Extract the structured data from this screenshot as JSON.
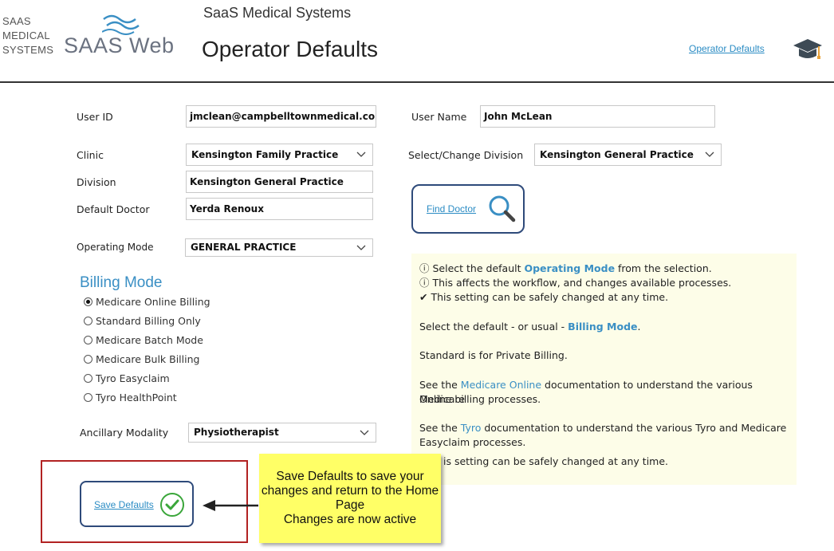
{
  "logo": {
    "line1": "SAAS",
    "line2": "MEDICAL",
    "line3": "SYSTEMS",
    "product": "SAAS Web"
  },
  "header": {
    "company": "SaaS Medical Systems",
    "title": "Operator Defaults",
    "link": "Operator Defaults"
  },
  "form": {
    "user_id_label": "User ID",
    "user_id_value": "jmclean@campbelltownmedical.com.au",
    "user_name_label": "User Name",
    "user_name_value": "John McLean",
    "clinic_label": "Clinic",
    "clinic_value": "Kensington Family Practice",
    "select_division_label": "Select/Change Division",
    "select_division_value": "Kensington General Practice",
    "division_label": "Division",
    "division_value": "Kensington General Practice",
    "default_doctor_label": "Default Doctor",
    "default_doctor_value": "Yerda Renoux",
    "operating_mode_label": "Operating Mode",
    "operating_mode_value": "GENERAL PRACTICE",
    "ancillary_label": "Ancillary Modality",
    "ancillary_value": "Physiotherapist"
  },
  "billing": {
    "title": "Billing Mode",
    "options": [
      {
        "label": "Medicare Online Billing",
        "selected": true
      },
      {
        "label": "Standard Billing Only",
        "selected": false
      },
      {
        "label": "Medicare Batch Mode",
        "selected": false
      },
      {
        "label": "Medicare Bulk Billing",
        "selected": false
      },
      {
        "label": "Tyro Easyclaim",
        "selected": false
      },
      {
        "label": "Tyro HealthPoint",
        "selected": false
      }
    ]
  },
  "find_doctor": {
    "label": "Find Doctor",
    "icon": "magnifier-icon"
  },
  "info": {
    "l1_pre": "Select the default ",
    "l1_kw": "Operating Mode",
    "l1_post": " from the selection.",
    "l2": "This affects the workflow, and changes available processes.",
    "l3": "This setting can be safely changed at any time.",
    "l4_pre": "Select the default - or usual - ",
    "l4_kw": "Billing Mode",
    "l4_post": ".",
    "l5": "Standard is for Private Billing.",
    "l6_pre": "See the ",
    "l6_kw": "Medicare Online",
    "l6_post": " documentation to understand the various Medicare",
    "l6b": "Online billing processes.",
    "l7_pre": "See the ",
    "l7_kw": "Tyro",
    "l7_post": " documentation to understand the various Tyro and Medicare",
    "l7b": "Easyclaim processes.",
    "l8": "is setting can be safely changed at any time."
  },
  "save": {
    "label": "Save Defaults",
    "icon": "checkmark-icon"
  },
  "callout": {
    "l1": "Save Defaults to save your",
    "l2": "changes and return to the Home",
    "l3": "Page",
    "l4": "Changes are now active"
  },
  "colors": {
    "accent": "#3a8fc4",
    "button_border": "#2e4a7a",
    "callout_bg": "#ffff66",
    "info_bg": "#fdfde8",
    "highlight_box": "#b22222"
  }
}
